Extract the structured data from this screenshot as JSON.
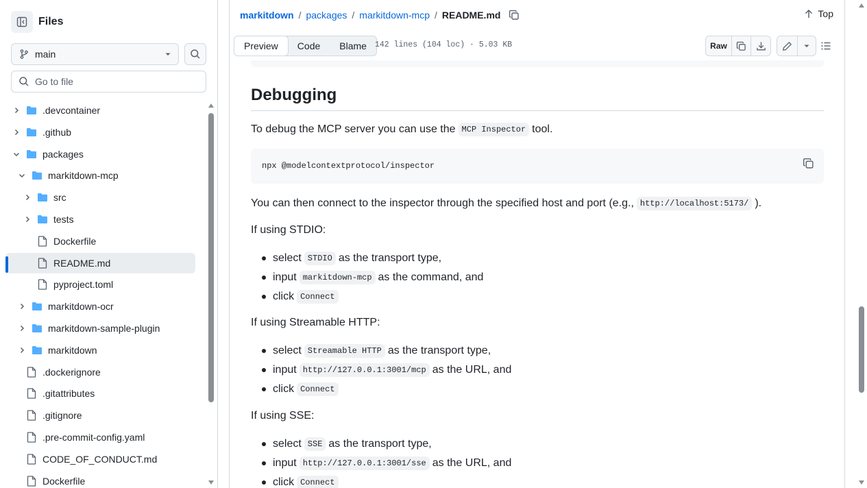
{
  "sidebar": {
    "title": "Files",
    "branch": "main",
    "goto_placeholder": "Go to file",
    "items": [
      {
        "name": ".devcontainer",
        "type": "folder",
        "chev": "right"
      },
      {
        "name": ".github",
        "type": "folder",
        "chev": "right"
      },
      {
        "name": "packages",
        "type": "folder",
        "chev": "down"
      },
      {
        "name": "markitdown-mcp",
        "type": "folder",
        "chev": "down"
      },
      {
        "name": "src",
        "type": "folder",
        "chev": "right"
      },
      {
        "name": "tests",
        "type": "folder",
        "chev": "right"
      },
      {
        "name": "Dockerfile",
        "type": "file",
        "chev": "none"
      },
      {
        "name": "README.md",
        "type": "file",
        "chev": "none"
      },
      {
        "name": "pyproject.toml",
        "type": "file",
        "chev": "none"
      },
      {
        "name": "markitdown-ocr",
        "type": "folder",
        "chev": "right"
      },
      {
        "name": "markitdown-sample-plugin",
        "type": "folder",
        "chev": "right"
      },
      {
        "name": "markitdown",
        "type": "folder",
        "chev": "right"
      },
      {
        "name": ".dockerignore",
        "type": "file",
        "chev": "none"
      },
      {
        "name": ".gitattributes",
        "type": "file",
        "chev": "none"
      },
      {
        "name": ".gitignore",
        "type": "file",
        "chev": "none"
      },
      {
        "name": ".pre-commit-config.yaml",
        "type": "file",
        "chev": "none"
      },
      {
        "name": "CODE_OF_CONDUCT.md",
        "type": "file",
        "chev": "none"
      },
      {
        "name": "Dockerfile",
        "type": "file",
        "chev": "none"
      }
    ]
  },
  "breadcrumb": {
    "repo": "markitdown",
    "parts": [
      "packages",
      "markitdown-mcp"
    ],
    "current": "README.md"
  },
  "top_label": "Top",
  "tabs": [
    "Preview",
    "Code",
    "Blame"
  ],
  "active_tab": "Preview",
  "file_info": "142 lines (104 loc) · 5.03 KB",
  "raw_label": "Raw",
  "readme": {
    "heading": "Debugging",
    "p1_before": "To debug the MCP server you can use the",
    "p1_code": "MCP Inspector",
    "p1_after": "tool.",
    "codeblock": "npx @modelcontextprotocol/inspector",
    "p2_before": "You can then connect to the inspector through the specified host and port (e.g.,",
    "p2_code": "http://localhost:5173/",
    "p2_after": ").",
    "stdio_title": "If using STDIO:",
    "stdio": [
      {
        "before": "select",
        "code": "STDIO",
        "after": "as the transport type,"
      },
      {
        "before": "input",
        "code": "markitdown-mcp",
        "after": "as the command, and"
      },
      {
        "before": "click",
        "code": "Connect",
        "after": ""
      }
    ],
    "http_title": "If using Streamable HTTP:",
    "http": [
      {
        "before": "select",
        "code": "Streamable HTTP",
        "after": "as the transport type,"
      },
      {
        "before": "input",
        "code": "http://127.0.0.1:3001/mcp",
        "after": "as the URL, and"
      },
      {
        "before": "click",
        "code": "Connect",
        "after": ""
      }
    ],
    "sse_title": "If using SSE:",
    "sse": [
      {
        "before": "select",
        "code": "SSE",
        "after": "as the transport type,"
      },
      {
        "before": "input",
        "code": "http://127.0.0.1:3001/sse",
        "after": "as the URL, and"
      },
      {
        "before": "click",
        "code": "Connect",
        "after": ""
      }
    ]
  },
  "colors": {
    "accent": "#0969da",
    "folder": "#54aeff",
    "text": "#1f2328",
    "muted": "#59636e"
  }
}
